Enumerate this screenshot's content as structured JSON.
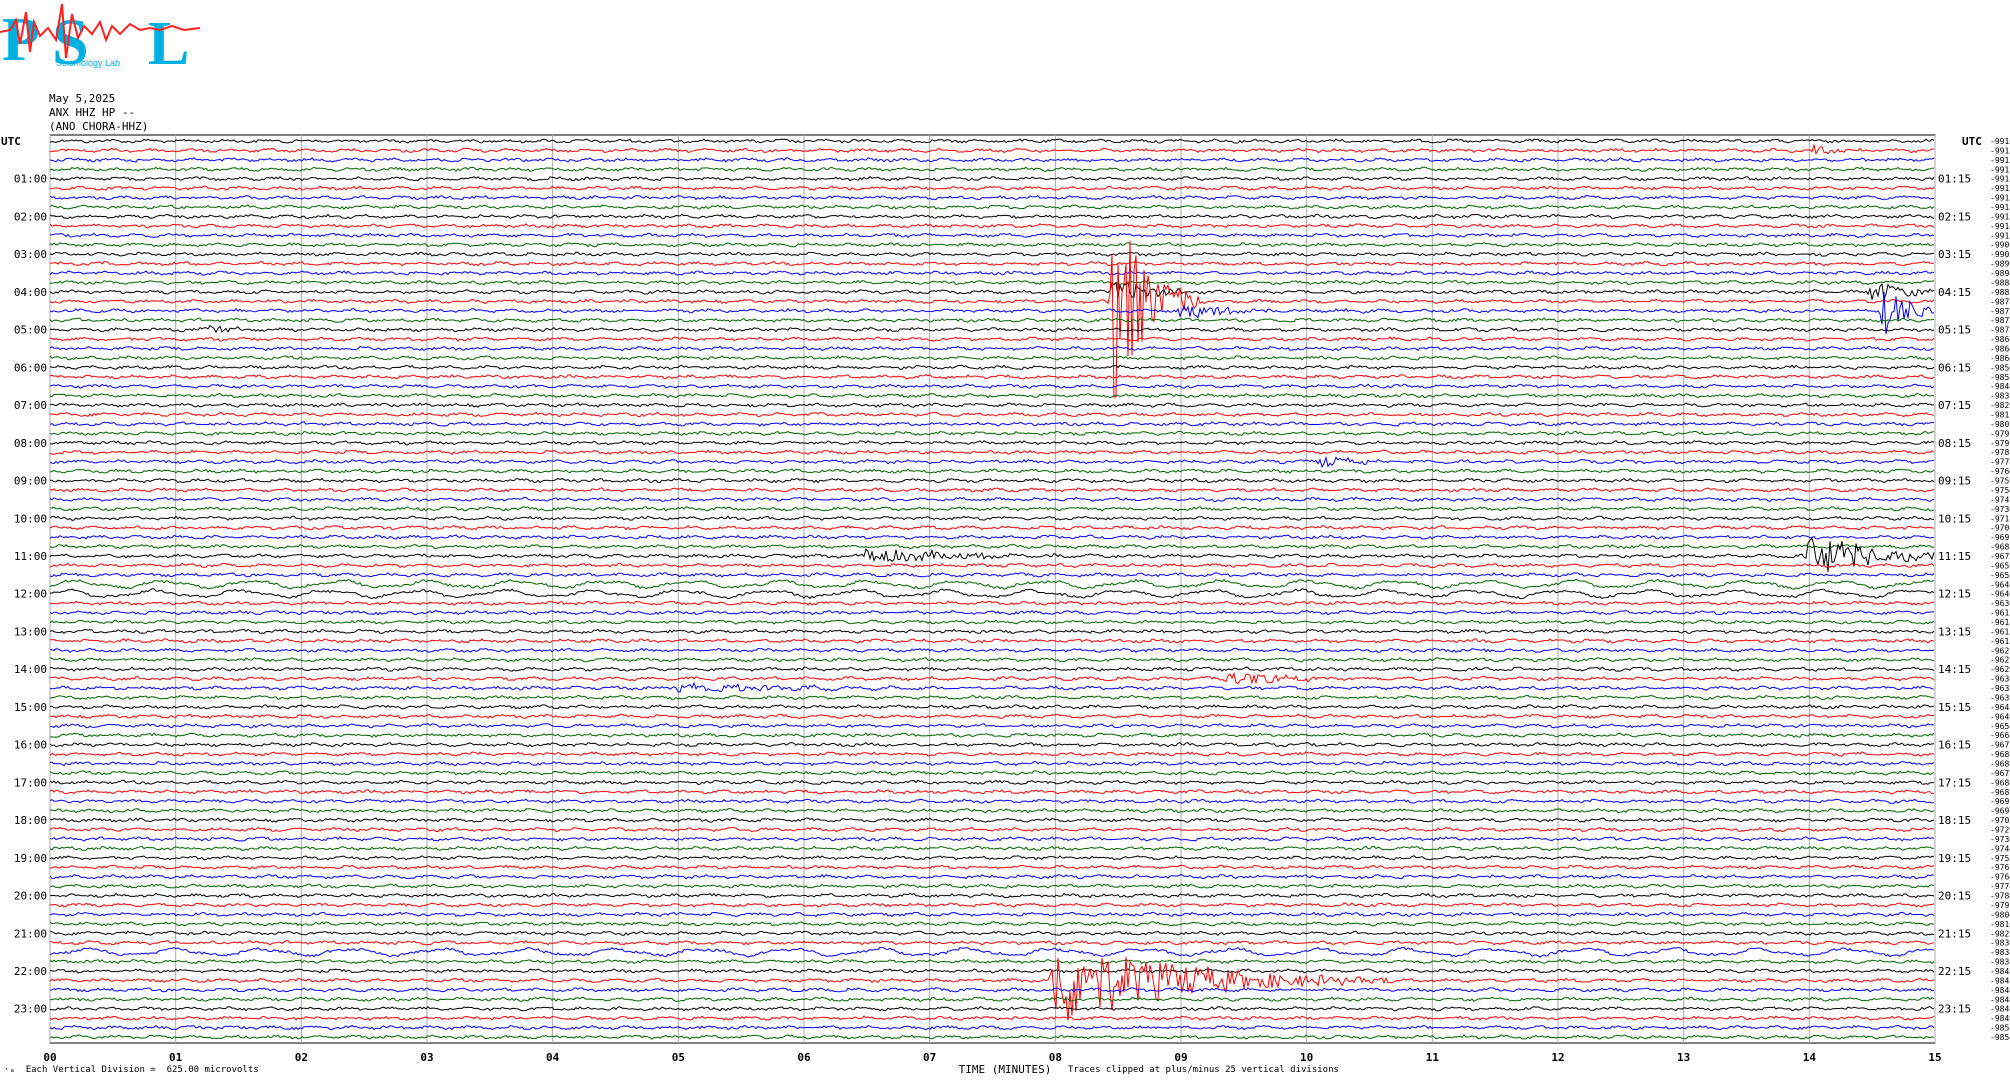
{
  "header": {
    "logo_text": "PSL",
    "logo_sub": "Seismology Lab",
    "date": "May 5,2025",
    "station": "ANX HHZ HP --",
    "network": "(ANO CHORA-HHZ)"
  },
  "colors": {
    "black": "#000000",
    "red": "#ff0000",
    "blue": "#0000ff",
    "green": "#006400",
    "grid": "#aaaaaa"
  },
  "chart_data": {
    "type": "line",
    "title": "",
    "xlabel": "TIME (MINUTES)",
    "ylabel": "",
    "xlim": [
      0,
      15
    ],
    "x_ticks": [
      "00",
      "01",
      "02",
      "03",
      "04",
      "05",
      "06",
      "07",
      "08",
      "09",
      "10",
      "11",
      "12",
      "13",
      "14",
      "15"
    ],
    "left_axis_label": "UTC",
    "right_axis_label": "UTC",
    "left_hours": [
      "01:00",
      "02:00",
      "03:00",
      "04:00",
      "05:00",
      "06:00",
      "07:00",
      "08:00",
      "09:00",
      "10:00",
      "11:00",
      "12:00",
      "13:00",
      "14:00",
      "15:00",
      "16:00",
      "17:00",
      "18:00",
      "19:00",
      "20:00",
      "21:00",
      "22:00",
      "23:00"
    ],
    "right_hours": [
      "01:15",
      "02:15",
      "03:15",
      "04:15",
      "05:15",
      "06:15",
      "07:15",
      "08:15",
      "09:15",
      "10:15",
      "11:15",
      "12:15",
      "13:15",
      "14:15",
      "15:15",
      "16:15",
      "17:15",
      "18:15",
      "19:15",
      "20:15",
      "21:15",
      "22:15",
      "23:15"
    ],
    "trace_colors": [
      "black",
      "red",
      "blue",
      "green"
    ],
    "trace_offsets": [
      "-9910",
      "-9912",
      "-9915",
      "-9917",
      "-9918",
      "-9917",
      "-9915",
      "-9918",
      "-9915",
      "-9914",
      "-9912",
      "-9909",
      "-9905",
      "-9899",
      "-9894",
      "-9888",
      "-9882",
      "-9878",
      "-9873",
      "-9873",
      "-9873",
      "-9866",
      "-9868",
      "-9866",
      "-9856",
      "-9852",
      "-9848",
      "-9835",
      "-9820",
      "-9815",
      "-9807",
      "-9797",
      "-9791",
      "-9781",
      "-9778",
      "-9766",
      "-9759",
      "-9754",
      "-9742",
      "-9736",
      "-9718",
      "-9708",
      "-9691",
      "-9682",
      "-9673",
      "-9659",
      "-9652",
      "-9646",
      "-9640",
      "-9630",
      "-9617",
      "-9614",
      "-9615",
      "-9618",
      "-9621",
      "-9622",
      "-9629",
      "-9630",
      "-9632",
      "-9639",
      "-9645",
      "-9649",
      "-9656",
      "-9663",
      "-9672",
      "-9680",
      "-9680",
      "-9678",
      "-9684",
      "-9687",
      "-9695",
      "-9697",
      "-9705",
      "-9720",
      "-9736",
      "-9744",
      "-9753",
      "-9761",
      "-9768",
      "-9774",
      "-9784",
      "-9792",
      "-9804",
      "-9816",
      "-9823",
      "-9830",
      "-9834",
      "-9835",
      "-9843",
      "-9843",
      "-9846",
      "-9848",
      "-9848",
      "-9849",
      "-9852",
      "-9854"
    ],
    "events": [
      {
        "row": 1,
        "t_min": 14.05,
        "amp": 0.6,
        "dur": 0.15
      },
      {
        "row": 16,
        "t_min": 8.45,
        "amp": 1.4,
        "dur": 0.3
      },
      {
        "row": 17,
        "t_min": 8.45,
        "amp": 12.0,
        "dur": 0.25
      },
      {
        "row": 18,
        "t_min": 9.0,
        "amp": 0.8,
        "dur": 0.5
      },
      {
        "row": 16,
        "t_min": 14.5,
        "amp": 1.2,
        "dur": 0.3
      },
      {
        "row": 18,
        "t_min": 14.6,
        "amp": 2.5,
        "dur": 0.25
      },
      {
        "row": 20,
        "t_min": 1.25,
        "amp": 0.6,
        "dur": 0.2
      },
      {
        "row": 34,
        "t_min": 10.1,
        "amp": 0.6,
        "dur": 0.25
      },
      {
        "row": 44,
        "t_min": 6.5,
        "amp": 1.0,
        "dur": 0.6
      },
      {
        "row": 44,
        "t_min": 14.0,
        "amp": 2.6,
        "dur": 0.5
      },
      {
        "row": 57,
        "t_min": 9.4,
        "amp": 1.0,
        "dur": 0.35
      },
      {
        "row": 58,
        "t_min": 5.0,
        "amp": 0.5,
        "dur": 0.9
      },
      {
        "row": 89,
        "t_min": 8.0,
        "amp": 5.0,
        "dur": 0.9
      }
    ]
  },
  "footer": {
    "left": "Each Vertical Division =  625.00 microvolts",
    "center_clip": "Traces clipped at plus/minus 25 vertical divisions"
  }
}
